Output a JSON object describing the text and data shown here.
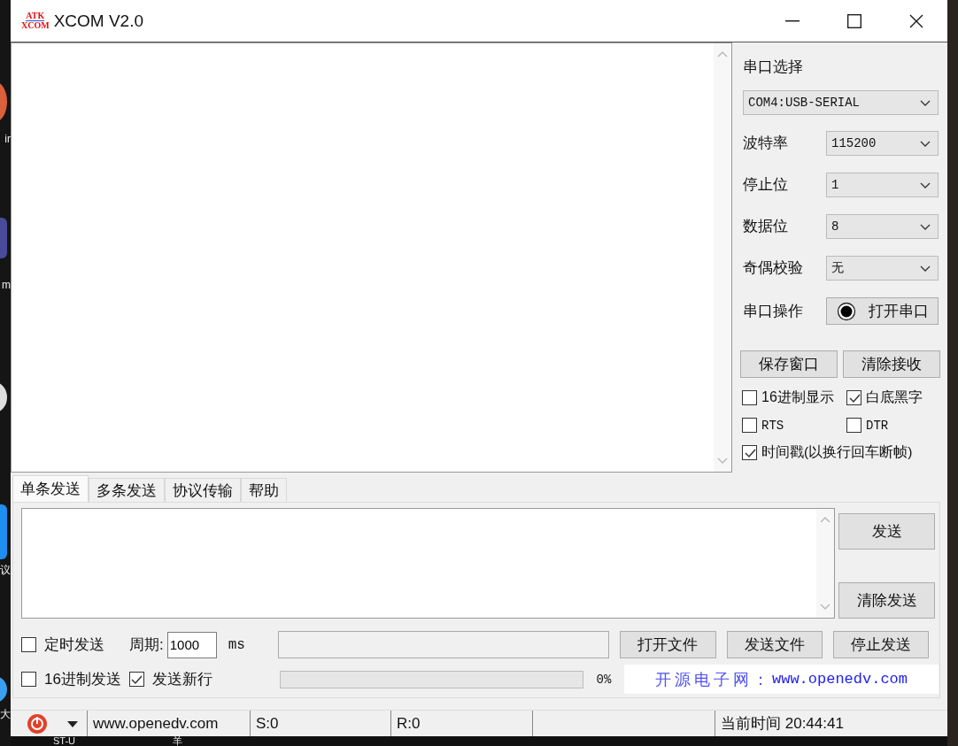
{
  "desktop": {
    "side_labels": [
      "ir",
      "m",
      "议",
      "大"
    ],
    "bottom_labels": [
      "ST-U",
      "羊"
    ]
  },
  "window": {
    "logo_top": "ATK",
    "logo_bottom": "XCOM",
    "title": "XCOM V2.0"
  },
  "serial": {
    "port_label": "串口选择",
    "port": "COM4:USB-SERIAL",
    "fields": [
      {
        "label": "波特率",
        "value": "115200"
      },
      {
        "label": "停止位",
        "value": "1"
      },
      {
        "label": "数据位",
        "value": "8"
      },
      {
        "label": "奇偶校验",
        "value": "无"
      }
    ],
    "operation": {
      "label": "串口操作",
      "button": "打开串口",
      "open": false
    }
  },
  "receive_buttons": [
    "保存窗口",
    "清除接收"
  ],
  "options": [
    {
      "label": "16进制显示",
      "checked": false
    },
    {
      "label": "白底黑字",
      "checked": true
    },
    {
      "label": "RTS",
      "checked": false
    },
    {
      "label": "DTR",
      "checked": false
    },
    {
      "label": "时间戳(以换行回车断帧)",
      "checked": true
    }
  ],
  "tabs": [
    {
      "label": "单条发送",
      "selected": true
    },
    {
      "label": "多条发送",
      "selected": false
    },
    {
      "label": "协议传输",
      "selected": false
    },
    {
      "label": "帮助",
      "selected": false
    }
  ],
  "send_buttons": [
    "发送",
    "清除发送"
  ],
  "timed_send": {
    "label": "定时发送",
    "checked": false
  },
  "period": {
    "label": "周期:",
    "value": "1000",
    "unit": "ms"
  },
  "file_buttons": [
    "打开文件",
    "发送文件",
    "停止发送"
  ],
  "hex_send": {
    "label": "16进制发送",
    "checked": false
  },
  "newline": {
    "label": "发送新行",
    "checked": true
  },
  "progress": {
    "level": 0,
    "reading": "0%"
  },
  "banner": {
    "prefix": "开源电子网：",
    "url": "www.openedv.com"
  },
  "status_bar": {
    "website": "www.openedv.com",
    "sent": "S:0",
    "received": "R:0",
    "time": "当前时间 20:44:41"
  }
}
